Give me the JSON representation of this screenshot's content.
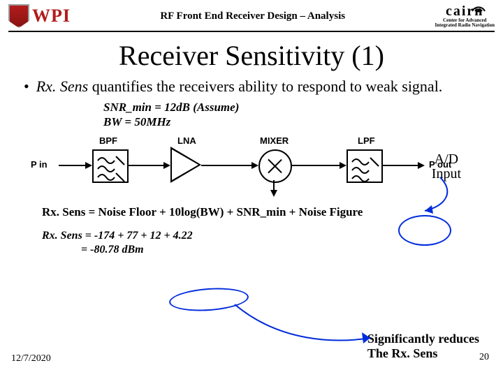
{
  "header": {
    "wpi": "WPI",
    "title": "RF Front End Receiver Design – Analysis",
    "cairn_main": "cairn",
    "cairn_sub1": "Center for Advanced",
    "cairn_sub2": "Integrated Radio Navigation"
  },
  "slide": {
    "title": "Receiver Sensitivity (1)",
    "bullet_prefix": "Rx. Sens",
    "bullet_rest": " quantifies the receivers ability to respond to weak signal.",
    "assume_line1": "SNR_min = 12dB (Assume)",
    "assume_line2": "BW = 50MHz",
    "ad_line1": "A/D",
    "ad_line2": "Input",
    "chain": {
      "pin": "P in",
      "bpf": "BPF",
      "lna": "LNA",
      "mixer": "MIXER",
      "lpf": "LPF",
      "pout": "P out"
    },
    "equation": "Rx. Sens = Noise Floor + 10log(BW) + SNR_min + Noise Figure",
    "calc_line1": "Rx. Sens = -174 + 77 + 12 + 4.22",
    "calc_line2": "              = -80.78 dBm",
    "sig_line1": "Significantly reduces",
    "sig_line2": "The Rx. Sens"
  },
  "footer": {
    "date": "12/7/2020",
    "page": "20"
  }
}
